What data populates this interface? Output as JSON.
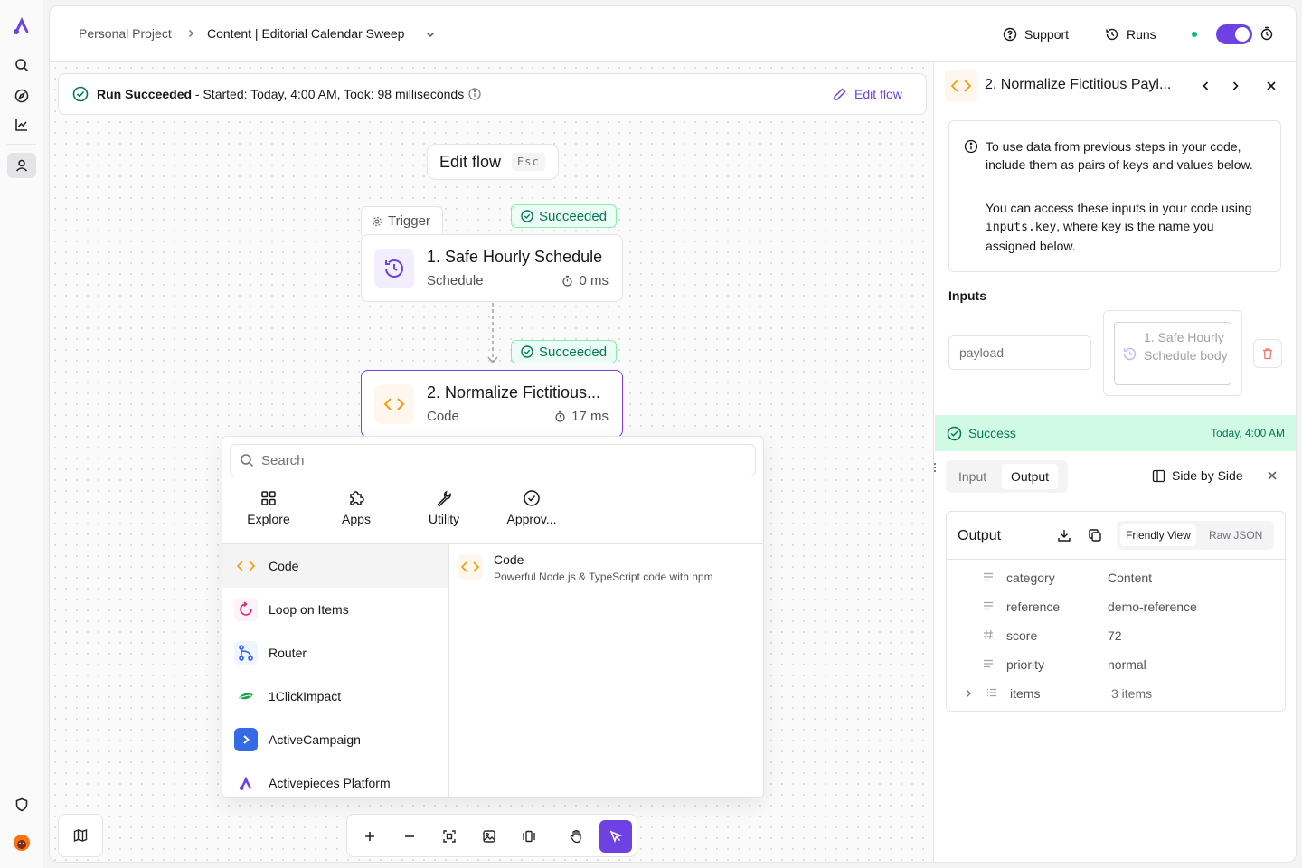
{
  "colors": {
    "brand": "#6e41e2",
    "success": "#047857",
    "success_bg": "#d1fae5",
    "border": "#e4e4e7"
  },
  "header": {
    "breadcrumb_project": "Personal Project",
    "flow_name": "Content | Editorial Calendar Sweep",
    "support_label": "Support",
    "runs_label": "Runs"
  },
  "run_banner": {
    "status": "Run Succeeded",
    "detail": " - Started: Today, 4:00 AM, Took: 98 milliseconds",
    "edit_label": "Edit flow"
  },
  "edit_flow_pill": {
    "label": "Edit flow",
    "shortcut": "Esc"
  },
  "flow": {
    "trigger_tab": "Trigger",
    "nodes": [
      {
        "status": "Succeeded",
        "title": "1. Safe Hourly Schedule",
        "subtitle": "Schedule",
        "duration": "0 ms",
        "icon": "clock-icon"
      },
      {
        "status": "Succeeded",
        "title": "2. Normalize Fictitious...",
        "subtitle": "Code",
        "duration": "17 ms",
        "icon": "code-icon"
      }
    ]
  },
  "picker": {
    "search_placeholder": "Search",
    "categories": [
      {
        "label": "Explore",
        "icon": "grid-icon"
      },
      {
        "label": "Apps",
        "icon": "puzzle-icon"
      },
      {
        "label": "Utility",
        "icon": "wrench-icon"
      },
      {
        "label": "Approv...",
        "icon": "check-circle-icon"
      }
    ],
    "items": [
      {
        "label": "Code",
        "icon": "code-icon"
      },
      {
        "label": "Loop on Items",
        "icon": "loop-icon"
      },
      {
        "label": "Router",
        "icon": "router-icon"
      },
      {
        "label": "1ClickImpact",
        "icon": "leaf-icon"
      },
      {
        "label": "ActiveCampaign",
        "icon": "chevron-right-icon"
      },
      {
        "label": "Activepieces Platform",
        "icon": "activepieces-logo-icon"
      }
    ],
    "detail": {
      "title": "Code",
      "description": "Powerful Node.js & TypeScript code with npm"
    }
  },
  "panel": {
    "step_title": "2. Normalize Fictitious Payl...",
    "info_p1": "To use data from previous steps in your code, include them as pairs of keys and values below.",
    "info_p2_a": "You can access these inputs in your code using ",
    "info_p2_code": "inputs.key",
    "info_p2_b": ", where key is the name you assigned below.",
    "inputs_label": "Inputs",
    "input_key_placeholder": "payload",
    "input_value": "1. Safe Hourly Schedule body",
    "success_label": "Success",
    "success_time": "Today, 4:00 AM",
    "tab_input": "Input",
    "tab_output": "Output",
    "side_by_side": "Side by Side",
    "output_title": "Output",
    "view_friendly": "Friendly View",
    "view_raw": "Raw JSON",
    "output_rows": [
      {
        "key": "category",
        "value": "Content",
        "type_icon": "text-icon"
      },
      {
        "key": "reference",
        "value": "demo-reference",
        "type_icon": "text-icon"
      },
      {
        "key": "score",
        "value": "72",
        "type_icon": "hash-icon"
      },
      {
        "key": "priority",
        "value": "normal",
        "type_icon": "text-icon"
      },
      {
        "key": "items",
        "value": "3 items",
        "type_icon": "list-icon"
      }
    ]
  }
}
